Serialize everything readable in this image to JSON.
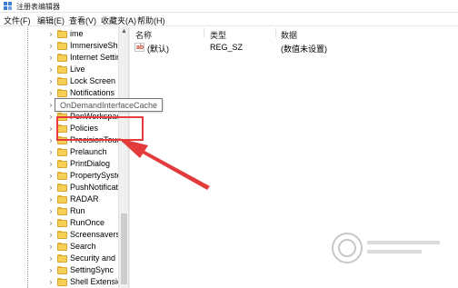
{
  "window": {
    "title": "注册表编辑器",
    "app_icon": "registry-editor-icon"
  },
  "menu": [
    {
      "label": "文件(F)"
    },
    {
      "label": "编辑(E)"
    },
    {
      "label": "查看(V)"
    },
    {
      "label": "收藏夹(A)"
    },
    {
      "label": "帮助(H)"
    }
  ],
  "tree": {
    "items": [
      {
        "label": "ime",
        "icon": "folder-icon"
      },
      {
        "label": "ImmersiveShe",
        "icon": "folder-icon"
      },
      {
        "label": "Internet Settin",
        "icon": "folder-icon"
      },
      {
        "label": "Live",
        "icon": "folder-icon"
      },
      {
        "label": "Lock Screen",
        "icon": "folder-icon"
      },
      {
        "label": "Notifications",
        "icon": "folder-icon"
      },
      {
        "label": "",
        "icon": "folder-icon"
      },
      {
        "label": "PenWorkspac",
        "icon": "folder-icon"
      },
      {
        "label": "Policies",
        "icon": "folder-icon"
      },
      {
        "label": "PrecisionTouc",
        "icon": "folder-icon"
      },
      {
        "label": "Prelaunch",
        "icon": "folder-icon"
      },
      {
        "label": "PrintDialog",
        "icon": "folder-icon"
      },
      {
        "label": "PropertySyste",
        "icon": "folder-icon"
      },
      {
        "label": "PushNotificati",
        "icon": "folder-icon"
      },
      {
        "label": "RADAR",
        "icon": "folder-icon"
      },
      {
        "label": "Run",
        "icon": "folder-icon"
      },
      {
        "label": "RunOnce",
        "icon": "folder-icon"
      },
      {
        "label": "Screensavers",
        "icon": "folder-icon"
      },
      {
        "label": "Search",
        "icon": "folder-icon"
      },
      {
        "label": "Security and M",
        "icon": "folder-icon"
      },
      {
        "label": "SettingSync",
        "icon": "folder-icon"
      },
      {
        "label": "Shell Extensio",
        "icon": "folder-icon"
      }
    ],
    "tooltip": "OnDemandInterfaceCache"
  },
  "list": {
    "headers": {
      "name": "名称",
      "type": "类型",
      "data": "数据"
    },
    "rows": [
      {
        "icon": "string-value-icon",
        "icon_text": "ab",
        "name": "(默认)",
        "type": "REG_SZ",
        "data": "(数值未设置)"
      }
    ]
  },
  "annotation": {
    "color": "#e63c3c",
    "target": "Policies"
  }
}
